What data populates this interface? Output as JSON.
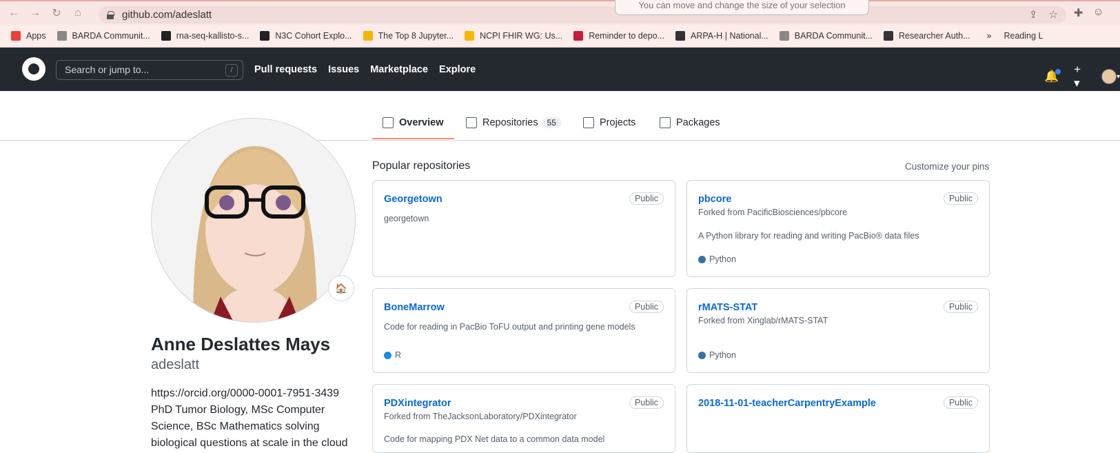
{
  "browser": {
    "url": "github.com/adeslatt",
    "tooltip": "You can move and change the size of your selection",
    "bookmarks": [
      {
        "label": "Apps",
        "color": "#e94235"
      },
      {
        "label": "BARDA Communit...",
        "color": "#888"
      },
      {
        "label": "rna-seq-kallisto-s...",
        "color": "#222"
      },
      {
        "label": "N3C Cohort Explo...",
        "color": "#222"
      },
      {
        "label": "The Top 8 Jupyter...",
        "color": "#f5b400"
      },
      {
        "label": "NCPI FHIR WG: Us...",
        "color": "#f6b800"
      },
      {
        "label": "Reminder to depo...",
        "color": "#c41e3a"
      },
      {
        "label": "ARPA-H | National...",
        "color": "#333"
      },
      {
        "label": "BARDA Communit...",
        "color": "#888"
      },
      {
        "label": "Researcher Auth...",
        "color": "#333"
      }
    ],
    "more": "»",
    "reading_list": "Reading L"
  },
  "github": {
    "search_placeholder": "Search or jump to...",
    "slash": "/",
    "nav": [
      "Pull requests",
      "Issues",
      "Marketplace",
      "Explore"
    ],
    "tabs": [
      {
        "label": "Overview"
      },
      {
        "label": "Repositories",
        "count": "55"
      },
      {
        "label": "Projects"
      },
      {
        "label": "Packages"
      }
    ]
  },
  "profile": {
    "name": "Anne Deslattes Mays",
    "login": "adeslatt",
    "bio_lines": [
      "https://orcid.org/0000-0001-7951-3439",
      "PhD Tumor Biology, MSc Computer",
      "Science, BSc Mathematics solving",
      "biological questions at scale in the cloud"
    ],
    "status_emoji": "🏠"
  },
  "repos_section": {
    "title": "Popular repositories",
    "customize": "Customize your pins",
    "cards": [
      {
        "name": "Georgetown",
        "badge": "Public",
        "desc": "georgetown"
      },
      {
        "name": "pbcore",
        "badge": "Public",
        "fork": "Forked from PacificBiosciences/pbcore",
        "desc": "A Python library for reading and writing PacBio® data files",
        "lang": "Python",
        "lang_color": "#3572A5"
      },
      {
        "name": "BoneMarrow",
        "badge": "Public",
        "desc": "Code for reading in PacBio ToFU output and printing gene models",
        "lang": "R",
        "lang_color": "#198CE7"
      },
      {
        "name": "rMATS-STAT",
        "badge": "Public",
        "fork": "Forked from Xinglab/rMATS-STAT",
        "lang": "Python",
        "lang_color": "#3572A5"
      },
      {
        "name": "PDXintegrator",
        "badge": "Public",
        "fork": "Forked from TheJacksonLaboratory/PDXintegrator",
        "desc": "Code for mapping PDX Net data to a common data model"
      },
      {
        "name": "2018-11-01-teacherCarpentryExample",
        "badge": "Public"
      }
    ]
  }
}
